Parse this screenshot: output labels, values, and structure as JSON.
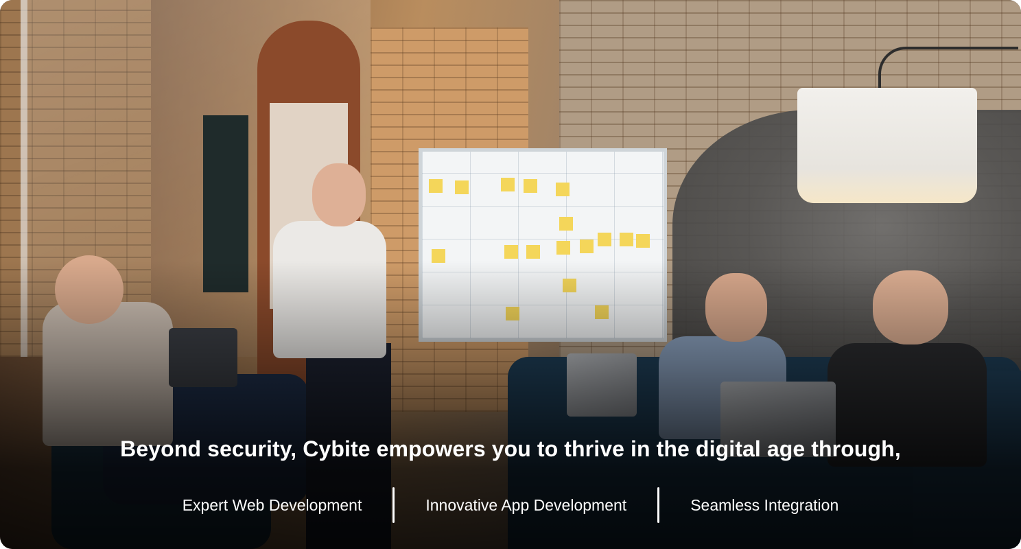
{
  "banner": {
    "headline": "Beyond security, Cybite empowers you to thrive in the digital age through,",
    "services": [
      {
        "label": "Expert Web Development"
      },
      {
        "label": "Innovative App Development"
      },
      {
        "label": "Seamless Integration"
      }
    ]
  },
  "colors": {
    "text": "#ffffff",
    "overlay": "#000000"
  }
}
